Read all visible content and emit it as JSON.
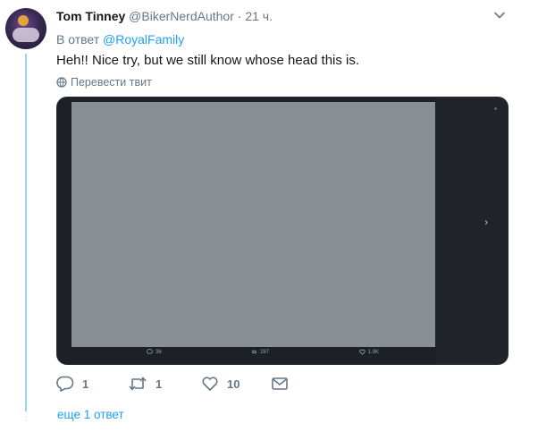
{
  "tweet": {
    "author_name": "Tom Tinney",
    "author_handle": "@BikerNerdAuthor",
    "separator": "·",
    "time": "21 ч.",
    "reply_prefix": "В ответ",
    "reply_to": "@RoyalFamily",
    "text": "Heh!! Nice try, but we still know whose head this is.",
    "translate_label": "Перевести твит"
  },
  "media": {
    "actions": [
      {
        "icon": "reply-icon",
        "count": "36"
      },
      {
        "icon": "retweet-icon",
        "count": "287"
      },
      {
        "icon": "like-icon",
        "count": "1.9K"
      }
    ],
    "next_arrow": "›"
  },
  "actions": {
    "reply_count": "1",
    "retweet_count": "1",
    "like_count": "10"
  },
  "thread": {
    "more_replies": "еще 1 ответ"
  },
  "colors": {
    "accent": "#1da1f2",
    "thread_line": "#9fd4f0",
    "secondary_text": "#657786"
  }
}
